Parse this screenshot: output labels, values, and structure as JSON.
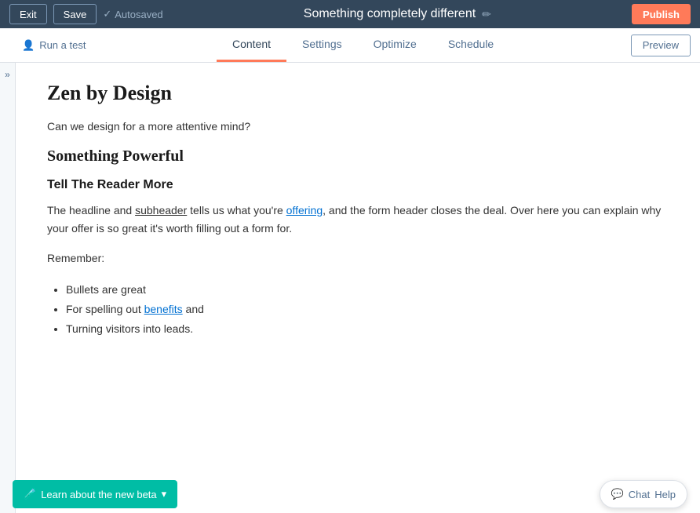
{
  "toolbar": {
    "exit_label": "Exit",
    "save_label": "Save",
    "autosaved_label": "Autosaved",
    "page_title": "Something completely different",
    "edit_icon": "✏",
    "publish_label": "Publish"
  },
  "nav": {
    "run_test_label": "Run a test",
    "tabs": [
      {
        "id": "content",
        "label": "Content",
        "active": true
      },
      {
        "id": "settings",
        "label": "Settings",
        "active": false
      },
      {
        "id": "optimize",
        "label": "Optimize",
        "active": false
      },
      {
        "id": "schedule",
        "label": "Schedule",
        "active": false
      }
    ],
    "preview_label": "Preview"
  },
  "editor": {
    "h1": "Zen by Design",
    "intro": "Can we design for a more attentive mind?",
    "h2": "Something Powerful",
    "h3": "Tell The Reader More",
    "body_text_1": "The headline and ",
    "body_underline": "subheader",
    "body_text_2": " tells us what you're ",
    "body_link": "offering",
    "body_text_3": ", and the form header closes the deal. Over here you can explain why your offer is so great it's worth filling out a form for.",
    "remember_label": "Remember:",
    "bullets": [
      "Bullets are great",
      "For spelling out {benefits} and",
      "Turning visitors into leads."
    ],
    "bullet_link": "benefits"
  },
  "bottom": {
    "learn_beta_label": "Learn about the new beta",
    "chat_label": "Chat",
    "help_label": "Help"
  }
}
